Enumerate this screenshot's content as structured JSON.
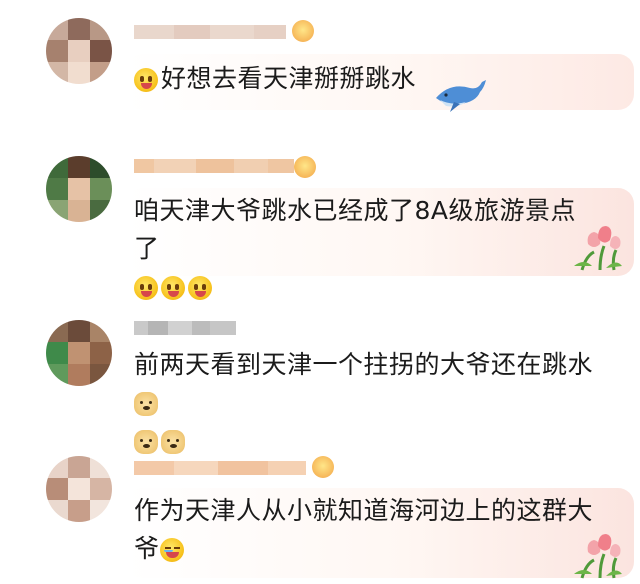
{
  "comments": [
    {
      "username": "",
      "text": "好想去看天津掰掰跳水",
      "leading_emojis": [
        "happy"
      ],
      "trailing_emojis": [],
      "decoration": "whale-sticker"
    },
    {
      "username": "",
      "text": "咱天津大爷跳水已经成了8A级旅游景点了",
      "leading_emojis": [],
      "trailing_emojis": [
        "happy",
        "happy",
        "happy"
      ],
      "decoration": "tulip-sticker"
    },
    {
      "username": "",
      "text": "前两天看到天津一个拄拐的大爷还在跳水",
      "leading_emojis": [],
      "trailing_emojis": [
        "doge",
        "doge",
        "doge"
      ],
      "decoration": ""
    },
    {
      "username": "",
      "text": "作为天津人从小就知道海河边上的这群大爷",
      "leading_emojis": [],
      "trailing_emojis": [
        "laugh"
      ],
      "decoration": "tulip-sticker"
    }
  ],
  "colors": {
    "text": "#1b1b1b",
    "bubble_tint": "#fde9e4",
    "badge": "#f4a530"
  },
  "icons": {
    "emoji_happy": "happy-emoji-icon",
    "emoji_doge": "doge-emoji-icon",
    "emoji_laugh": "laugh-cry-emoji-icon",
    "whale": "whale-sticker-icon",
    "tulip": "tulip-sticker-icon",
    "vip": "vip-badge-icon"
  }
}
